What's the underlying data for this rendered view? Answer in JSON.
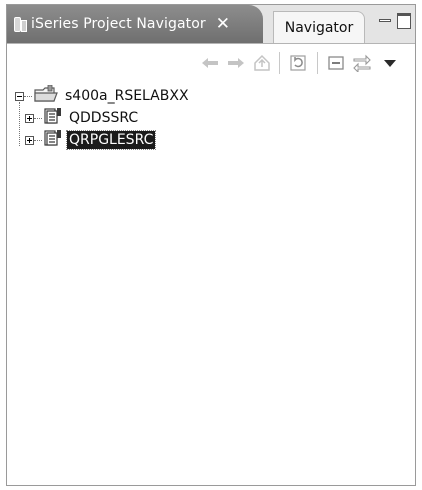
{
  "tabs": {
    "active_label": "iSeries Project Navigator",
    "close_glyph": "✕",
    "inactive_label": "Navigator"
  },
  "toolbar": {
    "buttons": [
      "back-icon",
      "forward-icon",
      "up-icon",
      "refresh-icon",
      "collapse-all-icon",
      "link-editor-icon",
      "view-menu-icon"
    ]
  },
  "tree": {
    "root": {
      "label": "s400a_RSELABXX",
      "expanded": true
    },
    "children": [
      {
        "label": "QDDSSRC",
        "selected": false
      },
      {
        "label": "QRPGLESRC",
        "selected": true
      }
    ]
  }
}
